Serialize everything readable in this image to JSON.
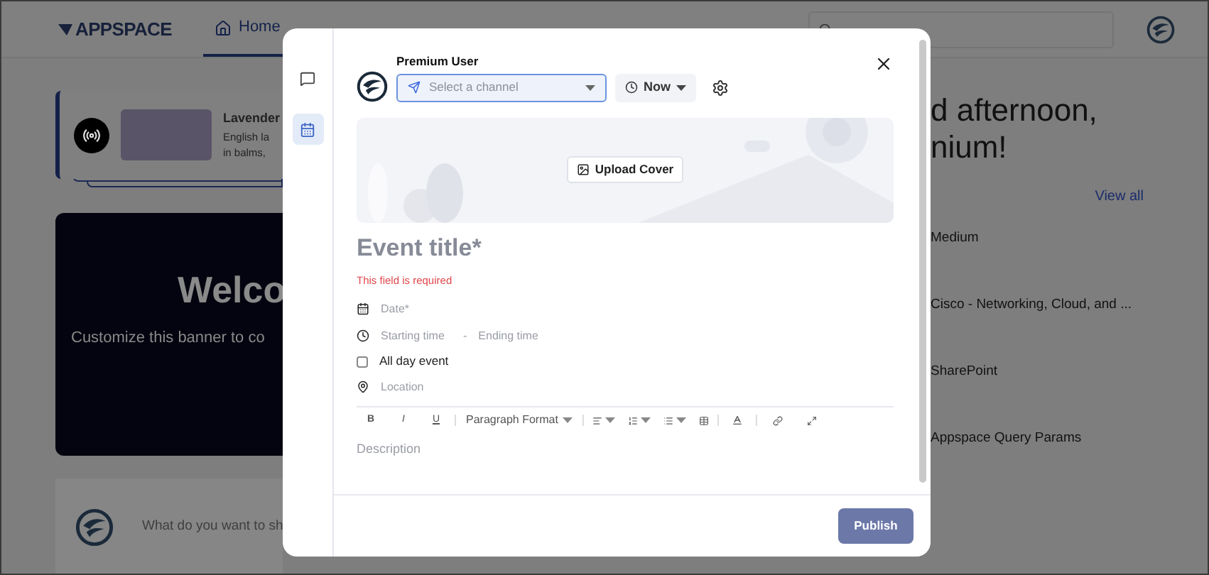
{
  "header": {
    "logo": "APPSPACE",
    "nav": [
      {
        "kind": "home",
        "label": "Home",
        "selected": true
      }
    ]
  },
  "feed_card": {
    "title": "Lavender",
    "lines": [
      "English la",
      "in balms,"
    ]
  },
  "banner": {
    "title": "Welco",
    "subtitle": "Customize this banner to co"
  },
  "composer": {
    "placeholder": "What do you want to sh"
  },
  "greeting": [
    "d afternoon,",
    "nium!"
  ],
  "channels": {
    "view_all": "View all",
    "items": [
      "Medium",
      "Cisco - Networking, Cloud, and ...",
      "SharePoint",
      "Appspace Query Params"
    ]
  },
  "modal": {
    "rail": [
      {
        "kind": "post",
        "selected": false
      },
      {
        "kind": "event",
        "selected": true
      }
    ],
    "user": "Premium User",
    "channel": {
      "placeholder": "Select a channel"
    },
    "schedule": "Now",
    "upload_cover": "Upload Cover",
    "title": {
      "placeholder": "Event title*"
    },
    "error": "This field is required",
    "date": {
      "placeholder": "Date*"
    },
    "start": {
      "placeholder": "Starting time"
    },
    "separator": "-",
    "end": {
      "placeholder": "Ending time"
    },
    "all_day": {
      "label": "All day event",
      "checked": false
    },
    "location": {
      "placeholder": "Location"
    },
    "toolbar": {
      "bold": "B",
      "italic": "I",
      "underline": "U",
      "format": "Paragraph Format"
    },
    "description": {
      "placeholder": "Description"
    },
    "publish": "Publish"
  }
}
